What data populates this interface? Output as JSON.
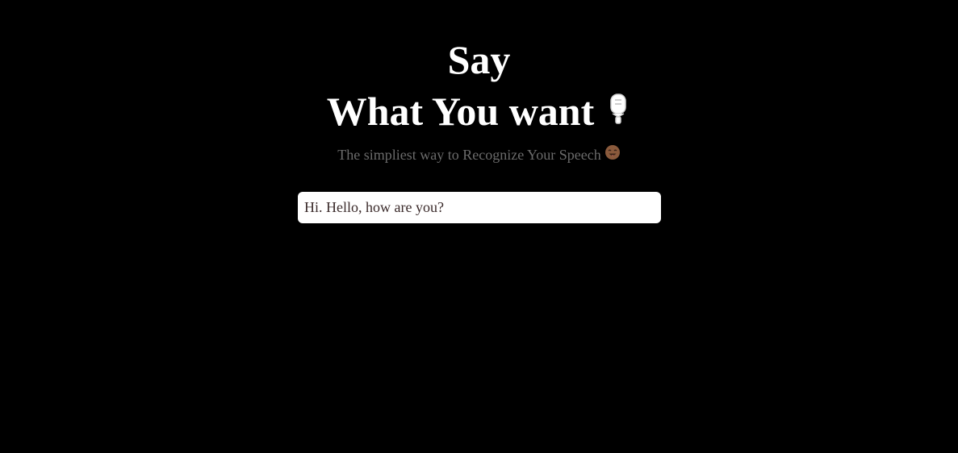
{
  "hero": {
    "title_line1": "Say",
    "title_line2": "What You want",
    "title_icon": "microphone-icon",
    "subtitle": "The simpliest way to Recognize Your Speech",
    "subtitle_icon": "smiling-face-emoji-icon"
  },
  "transcript": {
    "value": "Hi. Hello, how are you?"
  },
  "colors": {
    "background": "#000000",
    "title": "#ffffff",
    "subtitle": "#6b6b6b",
    "input_background": "#ffffff",
    "input_text": "#3a2a2a",
    "emoji": "#8a5a3c"
  }
}
